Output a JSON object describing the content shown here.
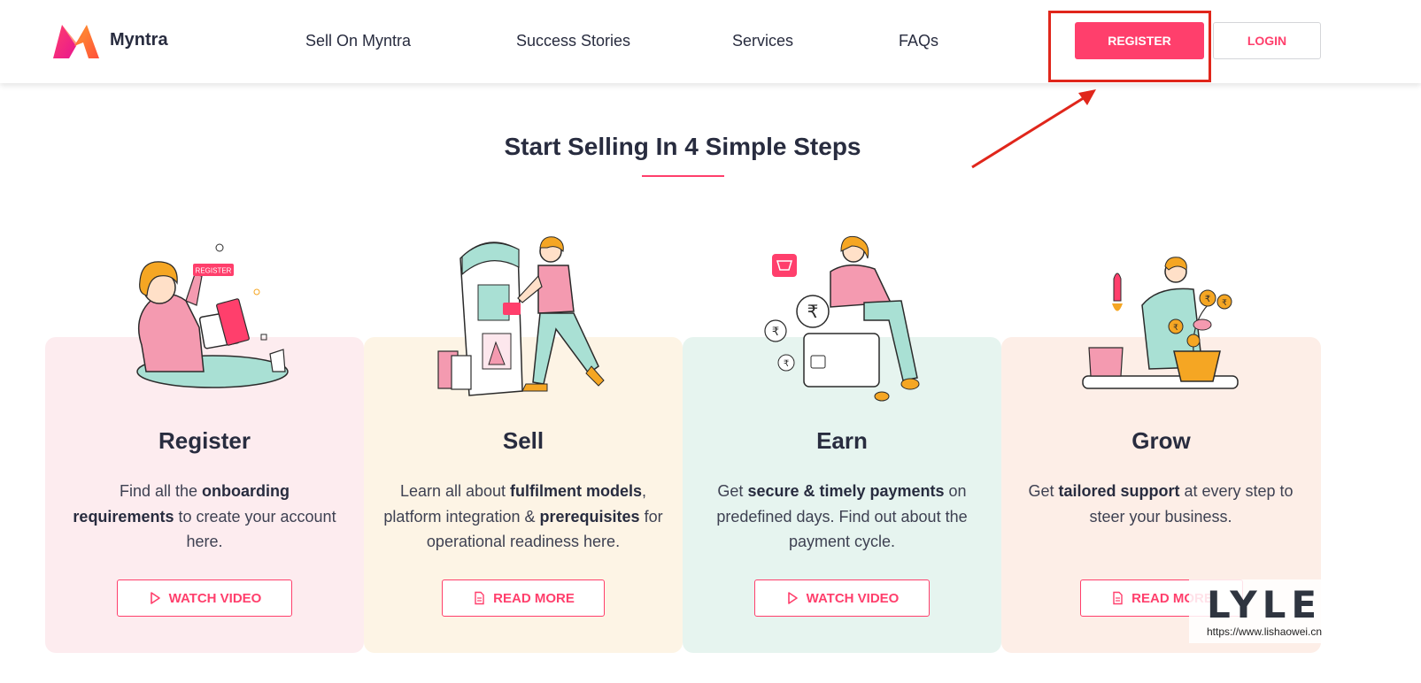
{
  "header": {
    "brand": "Myntra",
    "nav": [
      {
        "label": "Sell On Myntra"
      },
      {
        "label": "Success Stories"
      },
      {
        "label": "Services"
      },
      {
        "label": "FAQs"
      }
    ],
    "register_label": "REGISTER",
    "login_label": "LOGIN"
  },
  "section": {
    "title": "Start Selling In 4 Simple Steps"
  },
  "cards": [
    {
      "title": "Register",
      "desc_parts": [
        "Find all the ",
        "onboarding requirements",
        " to create your account here."
      ],
      "button": "WATCH VIDEO",
      "button_icon": "play-icon",
      "bg": "#fdecef",
      "illustration_badge": "REGISTER"
    },
    {
      "title": "Sell",
      "desc_parts": [
        "Learn all about ",
        "fulfilment models",
        ", platform integration & ",
        "prerequisites",
        " for operational readiness here."
      ],
      "button": "READ MORE",
      "button_icon": "document-icon",
      "bg": "#fdf4e5"
    },
    {
      "title": "Earn",
      "desc_parts": [
        "Get ",
        "secure & timely payments",
        " on predefined days. Find out about the payment cycle."
      ],
      "button": "WATCH VIDEO",
      "button_icon": "play-icon",
      "bg": "#e6f4ef"
    },
    {
      "title": "Grow",
      "desc_parts": [
        "Get ",
        "tailored support",
        " at every step to steer your business."
      ],
      "button": "READ MORE",
      "button_icon": "document-icon",
      "bg": "#fdeee7"
    }
  ],
  "colors": {
    "accent": "#ff3f6c",
    "annotation": "#e0261b"
  },
  "watermark": {
    "logo": "LYLE",
    "url": "https://www.lishaowei.cn"
  }
}
